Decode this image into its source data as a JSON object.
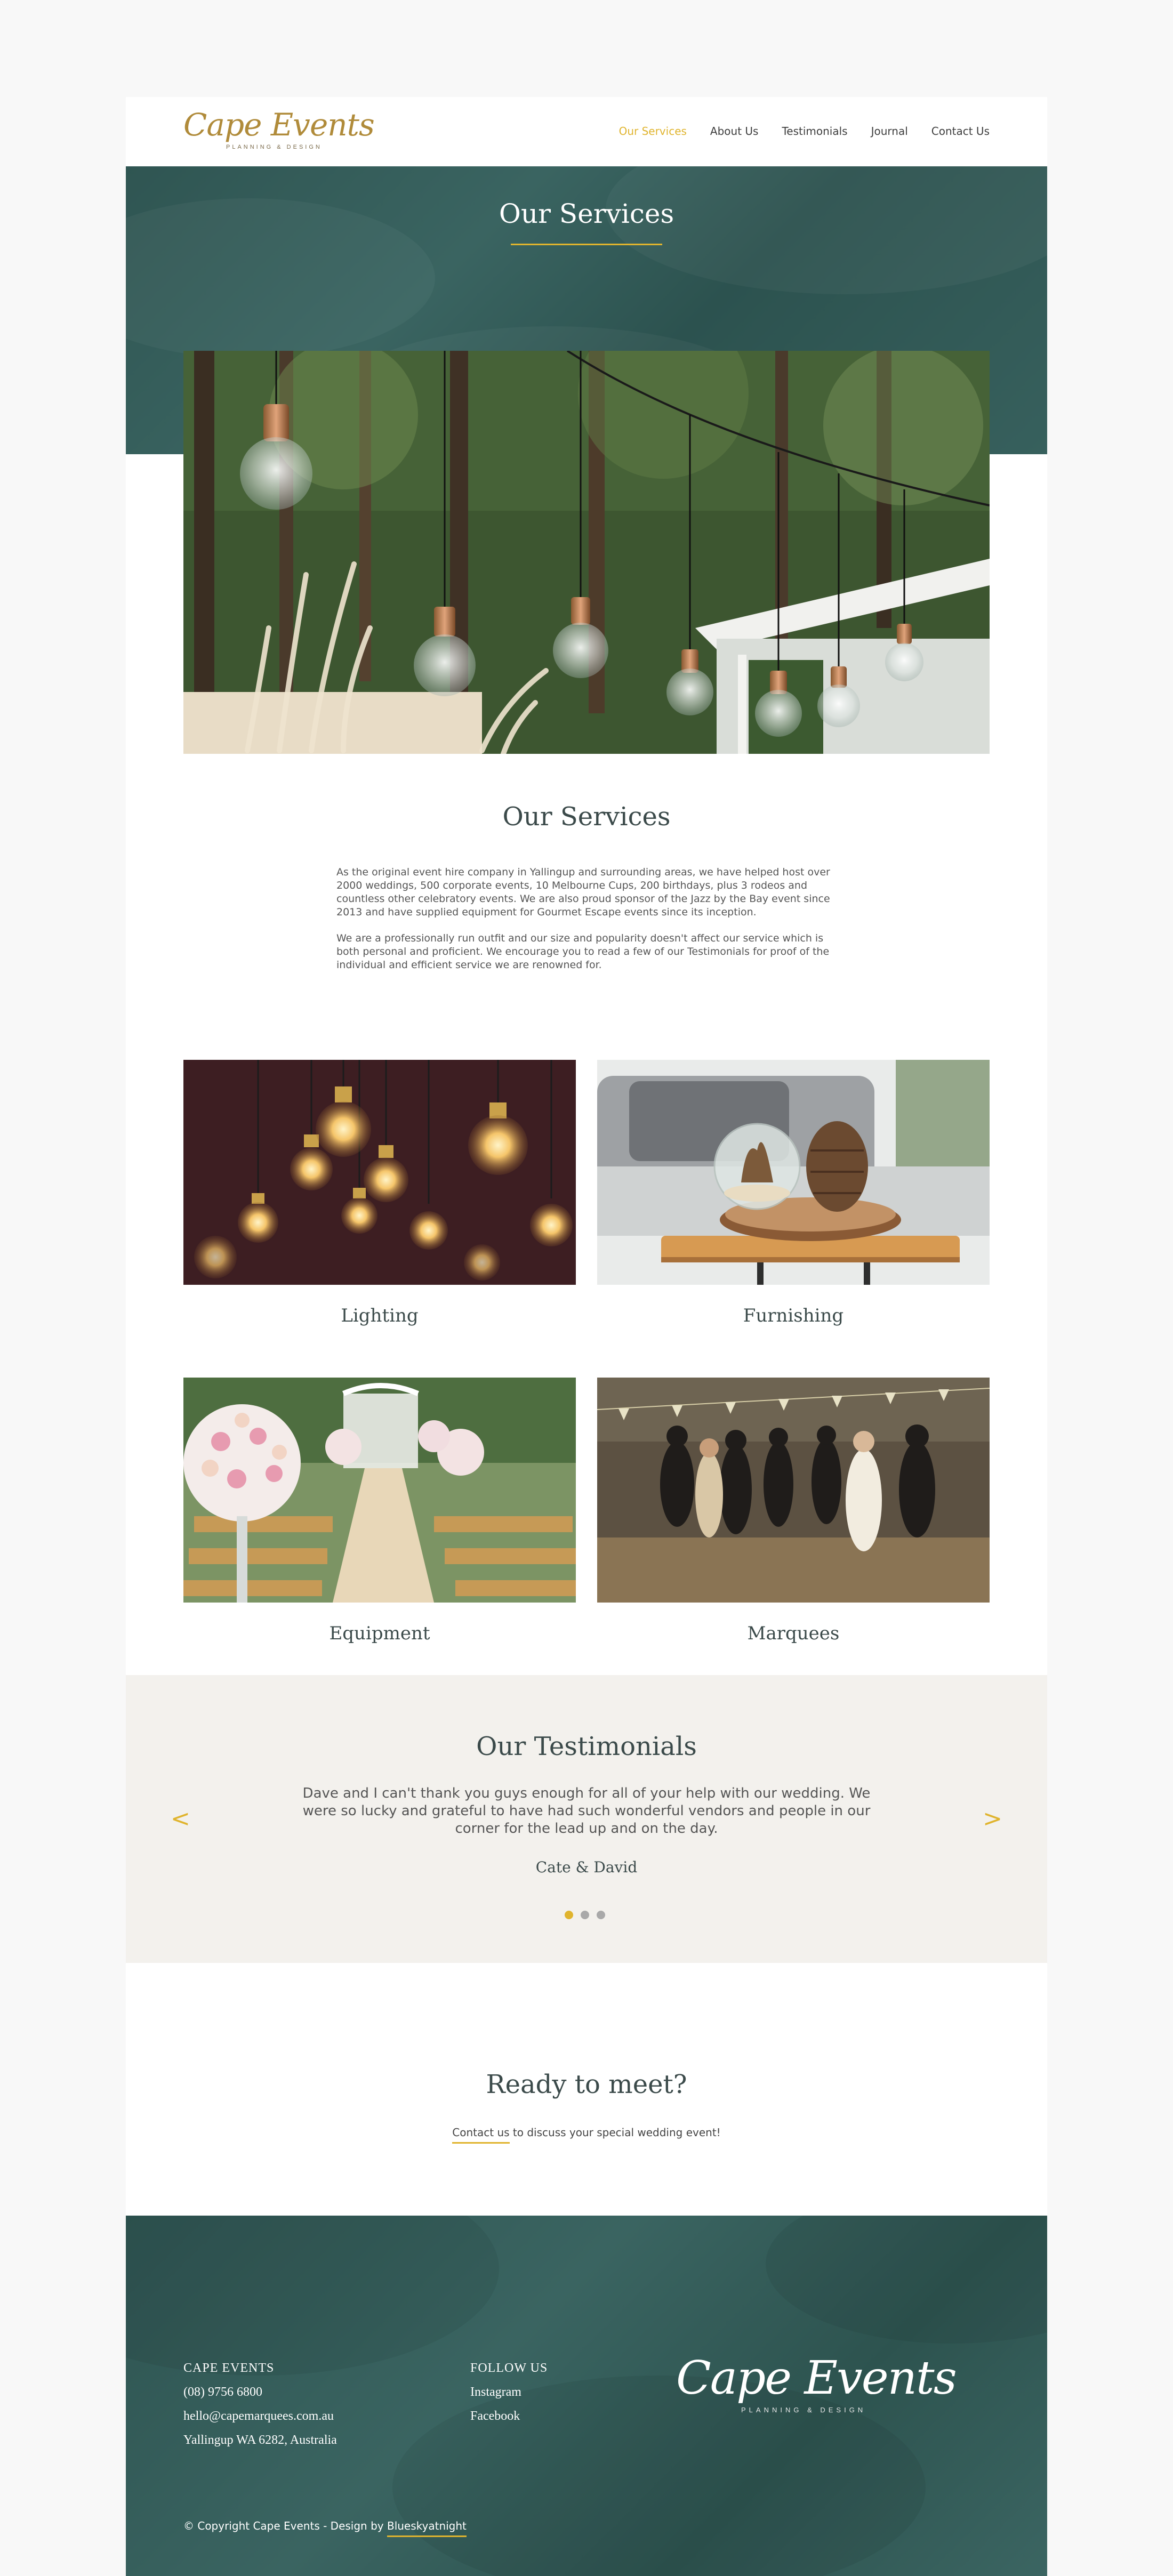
{
  "brand": {
    "name": "Cape Events",
    "tagline": "PLANNING & DESIGN"
  },
  "nav": {
    "items": [
      {
        "label": "Our Services",
        "active": true
      },
      {
        "label": "About Us",
        "active": false
      },
      {
        "label": "Testimonials",
        "active": false
      },
      {
        "label": "Journal",
        "active": false
      },
      {
        "label": "Contact Us",
        "active": false
      }
    ]
  },
  "hero": {
    "title": "Our Services"
  },
  "intro": {
    "title": "Our Services",
    "paragraphs": [
      "As the original event hire company in Yallingup and surrounding areas, we have helped host over 2000 weddings, 500 corporate events, 10 Melbourne Cups, 200 birthdays, plus 3 rodeos and countless other celebratory events. We are also proud sponsor of the Jazz by the Bay event since 2013 and have supplied equipment for Gourmet Escape events since its inception.",
      "We are a professionally run outfit and our size and popularity doesn't affect our service which is both personal and proficient. We encourage you to read a few of our Testimonials for proof of the individual and efficient service we are renowned for."
    ]
  },
  "services": [
    {
      "label": "Lighting"
    },
    {
      "label": "Furnishing"
    },
    {
      "label": "Equipment"
    },
    {
      "label": "Marquees"
    }
  ],
  "testimonials": {
    "title": "Our Testimonials",
    "quote": "Dave and I can't thank you guys enough for all of your help with our wedding. We were so lucky and grateful to have had such wonderful vendors and people in our corner for the lead up and on the day.",
    "author": "Cate & David",
    "prev": "<",
    "next": ">",
    "active_index": 0,
    "count": 3
  },
  "cta": {
    "title": "Ready to meet?",
    "link_label": "Contact us",
    "rest": " to discuss your special wedding event!"
  },
  "footer": {
    "contact_heading": "CAPE EVENTS",
    "phone": "(08) 9756 6800",
    "email": "hello@capemarquees.com.au",
    "address": "Yallingup WA 6282, Australia",
    "follow_heading": "FOLLOW US",
    "social": [
      "Instagram",
      "Facebook"
    ],
    "copyright_prefix": "© Copyright Cape Events - Design by ",
    "designer": "Blueskyatnight"
  },
  "colors": {
    "accent": "#e0b42e",
    "teal": "#365e5b",
    "heading": "#3b4a4a",
    "testimonial_bg": "#f3f1ed"
  }
}
